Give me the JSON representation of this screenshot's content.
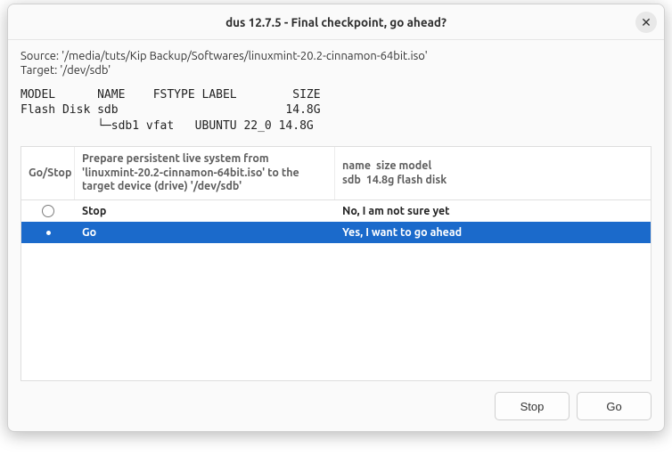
{
  "titlebar": {
    "title": "dus 12.7.5 - Final checkpoint, go ahead?"
  },
  "info": {
    "source_line": "Source: '/media/tuts/Kip Backup/Softwares/linuxmint-20.2-cinnamon-64bit.iso'",
    "target_line": "Target: '/dev/sdb'"
  },
  "device_table": "MODEL      NAME    FSTYPE LABEL        SIZE\nFlash Disk sdb                        14.8G\n           └─sdb1 vfat   UBUNTU 22_0 14.8G",
  "table": {
    "headers": {
      "gostop": "Go/Stop",
      "prepare": "Prepare  persistent live  system from 'linuxmint-20.2-cinnamon-64bit.iso' to the target device (drive) '/dev/sdb'",
      "device": "name  size model\nsdb  14.8g flash disk"
    },
    "rows": [
      {
        "action": "Stop",
        "desc": "No, I am not sure yet",
        "selected": false
      },
      {
        "action": "Go",
        "desc": "Yes, I want to go ahead",
        "selected": true
      }
    ]
  },
  "buttons": {
    "stop": "Stop",
    "go": "Go"
  }
}
